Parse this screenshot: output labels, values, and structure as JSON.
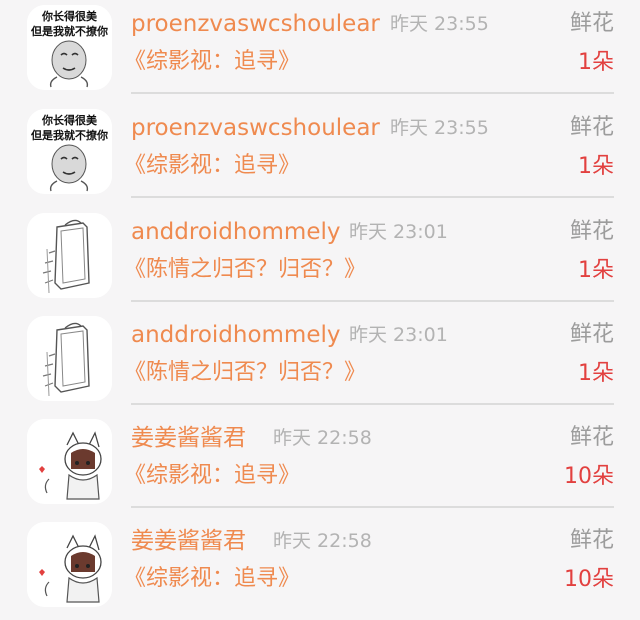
{
  "gifts": [
    {
      "avatar": "meme-face",
      "avatar_text_1": "你长得很美",
      "avatar_text_2": "但是我就不撩你",
      "username": "proenzvaswcshoulear",
      "time": "昨天 23:55",
      "gift": "鲜花",
      "work": "《综影视：追寻》",
      "quantity": "1朵"
    },
    {
      "avatar": "meme-face",
      "avatar_text_1": "你长得很美",
      "avatar_text_2": "但是我就不撩你",
      "username": "proenzvaswcshoulear",
      "time": "昨天 23:55",
      "gift": "鲜花",
      "work": "《综影视：追寻》",
      "quantity": "1朵"
    },
    {
      "avatar": "sketch-bag",
      "username": "anddroidhommely",
      "time": "昨天 23:01",
      "gift": "鲜花",
      "work": "《陈情之归否？归否？》",
      "quantity": "1朵"
    },
    {
      "avatar": "sketch-bag",
      "username": "anddroidhommely",
      "time": "昨天 23:01",
      "gift": "鲜花",
      "work": "《陈情之归否？归否？》",
      "quantity": "1朵"
    },
    {
      "avatar": "anime-cat-hood",
      "username": "姜姜酱酱君",
      "time": "昨天 22:58",
      "gift": "鲜花",
      "work": "《综影视：追寻》",
      "quantity": "10朵"
    },
    {
      "avatar": "anime-cat-hood",
      "username": "姜姜酱酱君",
      "time": "昨天 22:58",
      "gift": "鲜花",
      "work": "《综影视：追寻》",
      "quantity": "10朵"
    }
  ]
}
